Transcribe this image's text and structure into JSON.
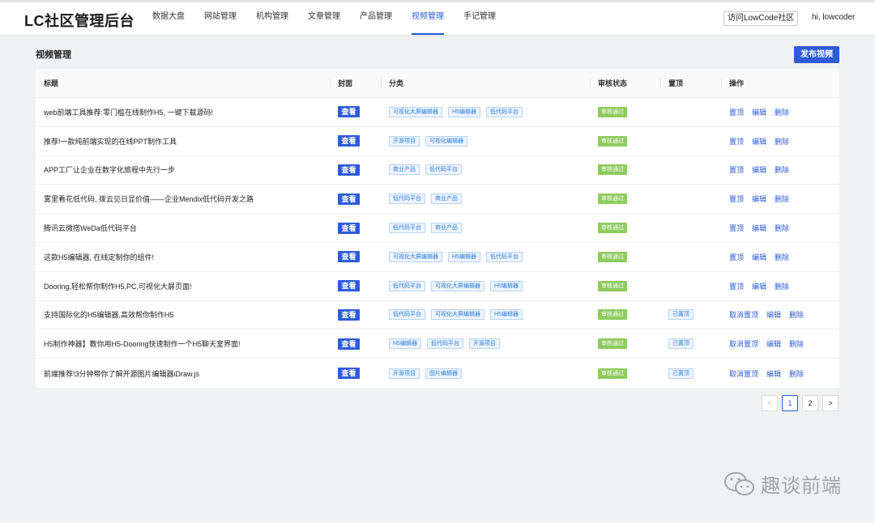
{
  "app": {
    "title": "LC社区管理后台"
  },
  "nav": {
    "items": [
      "数据大盘",
      "网站管理",
      "机构管理",
      "文章管理",
      "产品管理",
      "视频管理",
      "手记管理"
    ],
    "active_index": 5
  },
  "header": {
    "visit_label": "访问LowCode社区",
    "greeting": "hi, lowcoder"
  },
  "page": {
    "section_title": "视频管理",
    "publish_label": "发布视频"
  },
  "table": {
    "columns": [
      "标题",
      "封面",
      "分类",
      "审核状态",
      "置顶",
      "操作"
    ],
    "rows": [
      {
        "title": "web前端工具推荐:零门槛在线制作H5, 一键下载源码!",
        "cover": "查看",
        "tags": [
          "可视化大屏编辑器",
          "H5编辑器",
          "低代码平台"
        ],
        "status": "审核通过",
        "pinned": "",
        "ops": [
          "置顶",
          "编辑",
          "删除"
        ]
      },
      {
        "title": "推荐!一款纯前端实现的在线PPT制作工具",
        "cover": "查看",
        "tags": [
          "开源项目",
          "可视化编辑器"
        ],
        "status": "审核通过",
        "pinned": "",
        "ops": [
          "置顶",
          "编辑",
          "删除"
        ]
      },
      {
        "title": "APP工厂让企业在数字化旅程中先行一步",
        "cover": "查看",
        "tags": [
          "商业产品",
          "低代码平台"
        ],
        "status": "审核通过",
        "pinned": "",
        "ops": [
          "置顶",
          "编辑",
          "删除"
        ]
      },
      {
        "title": "雾里看花低代码, 拨云见日显价值——企业Mendix低代码开发之路",
        "cover": "查看",
        "tags": [
          "低代码平台",
          "商业产品"
        ],
        "status": "审核通过",
        "pinned": "",
        "ops": [
          "置顶",
          "编辑",
          "删除"
        ]
      },
      {
        "title": "腾讯云微搭WeDa低代码平台",
        "cover": "查看",
        "tags": [
          "低代码平台",
          "商业产品"
        ],
        "status": "审核通过",
        "pinned": "",
        "ops": [
          "置顶",
          "编辑",
          "删除"
        ]
      },
      {
        "title": "这款H5编辑器, 在线定制你的组件!",
        "cover": "查看",
        "tags": [
          "可视化大屏编辑器",
          "H5编辑器",
          "低代码平台"
        ],
        "status": "审核通过",
        "pinned": "",
        "ops": [
          "置顶",
          "编辑",
          "删除"
        ]
      },
      {
        "title": "Dooring,轻松帮你制作H5,PC,可视化大屏页面!",
        "cover": "查看",
        "tags": [
          "低代码平台",
          "可视化大屏编辑器",
          "H5编辑器"
        ],
        "status": "审核通过",
        "pinned": "",
        "ops": [
          "置顶",
          "编辑",
          "删除"
        ]
      },
      {
        "title": "支持国际化的H5编辑器,高效帮你制作H5",
        "cover": "查看",
        "tags": [
          "低代码平台",
          "可视化大屏编辑器",
          "H5编辑器"
        ],
        "status": "审核通过",
        "pinned": "已置顶",
        "ops": [
          "取消置顶",
          "编辑",
          "删除"
        ]
      },
      {
        "title": "H5制作神器】教你用H5-Dooring快速制作一个H5聊天室界面!",
        "cover": "查看",
        "tags": [
          "H5编辑器",
          "低代码平台",
          "开源项目"
        ],
        "status": "审核通过",
        "pinned": "已置顶",
        "ops": [
          "取消置顶",
          "编辑",
          "删除"
        ]
      },
      {
        "title": "前端推荐!3分钟带你了解开源图片编辑器iDraw.js",
        "cover": "查看",
        "tags": [
          "开源项目",
          "图片编辑器"
        ],
        "status": "审核通过",
        "pinned": "已置顶",
        "ops": [
          "取消置顶",
          "编辑",
          "删除"
        ]
      }
    ]
  },
  "pagination": {
    "prev": "<",
    "pages": [
      "1",
      "2"
    ],
    "current": "1",
    "next": ">"
  },
  "watermark": {
    "text": "趣谈前端",
    "icon": "wechat-icon"
  },
  "colors": {
    "primary": "#2e5bd9",
    "status_green": "#8fcb5e",
    "tag_blue": "#2e7bd9"
  }
}
